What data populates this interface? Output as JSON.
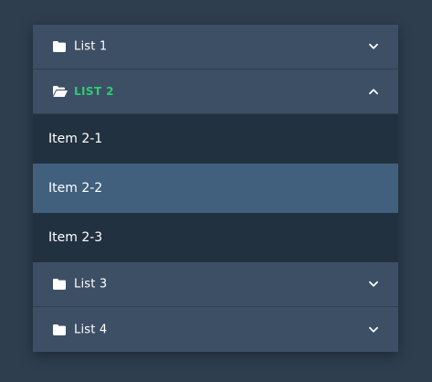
{
  "accordion": {
    "lists": [
      {
        "label": "List 1",
        "expanded": false,
        "icon": "folder-icon",
        "chevron": "chevron-down-icon"
      },
      {
        "label": "LIST 2",
        "expanded": true,
        "icon": "folder-open-icon",
        "chevron": "chevron-up-icon",
        "items": [
          {
            "label": "Item 2-1",
            "selected": false
          },
          {
            "label": "Item 2-2",
            "selected": true
          },
          {
            "label": "Item 2-3",
            "selected": false
          }
        ]
      },
      {
        "label": "List 3",
        "expanded": false,
        "icon": "folder-icon",
        "chevron": "chevron-down-icon"
      },
      {
        "label": "List 4",
        "expanded": false,
        "icon": "folder-icon",
        "chevron": "chevron-down-icon"
      }
    ]
  },
  "colors": {
    "background": "#2e3e4f",
    "header": "#3c4f65",
    "sub_item": "#223140",
    "selected_item": "#40607e",
    "active_label": "#2ecc71",
    "text": "#ffffff"
  }
}
